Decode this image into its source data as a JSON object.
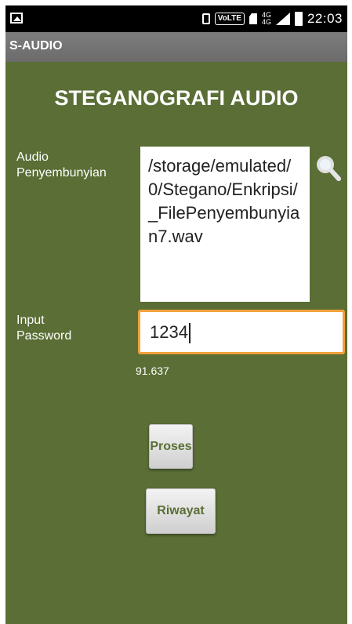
{
  "status_bar": {
    "time": "22:03",
    "volte": "VoLTE",
    "network": "4G",
    "network_up": "4G"
  },
  "app_bar": {
    "title": "S-AUDIO"
  },
  "main": {
    "heading": "STEGANOGRAFI AUDIO",
    "audio_label_line1": "Audio",
    "audio_label_line2": "Penyembunyian",
    "audio_path": "/storage/emulated/0/Stegano/Enkripsi/_FilePenyembunyian7.wav",
    "password_label_line1": "Input",
    "password_label_line2": "Password",
    "password_value": "1234",
    "value_text": "91.637",
    "proses_label": "Proses",
    "riwayat_label": "Riwayat"
  },
  "colors": {
    "background": "#5a6e35",
    "focus_border": "#f2a13a",
    "button_text": "#5a6e35"
  }
}
